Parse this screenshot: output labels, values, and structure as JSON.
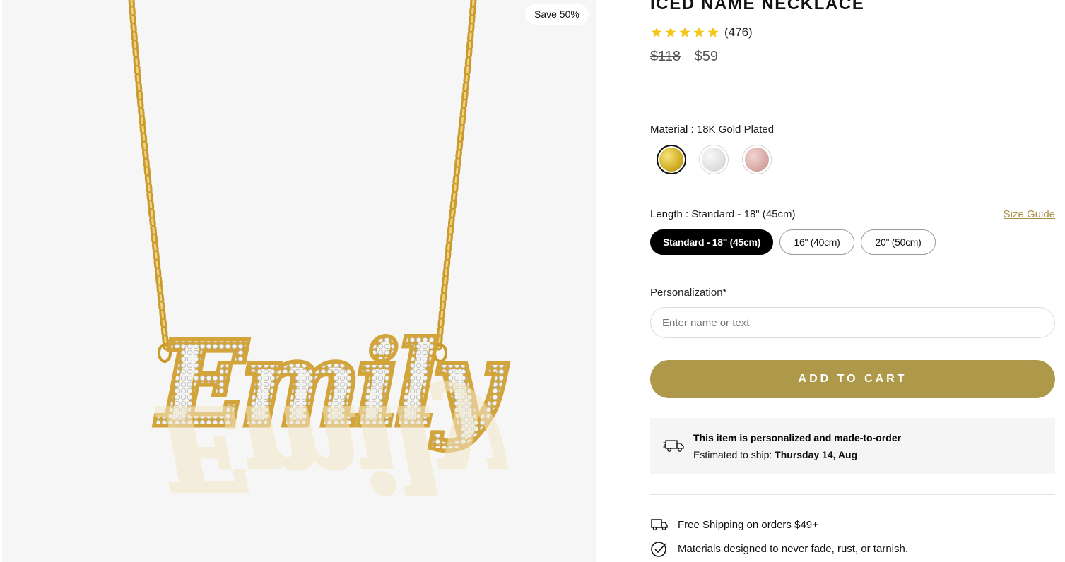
{
  "product": {
    "title": "ICED NAME NECKLACE",
    "badge": "Save 50%",
    "rating_value": 5,
    "star_color": "#f5c518",
    "review_count": "(476)",
    "price_original": "$118",
    "price_sale": "$59",
    "necklace_name": "Emily"
  },
  "material": {
    "label": "Material :",
    "selected": "18K Gold Plated",
    "swatches": [
      {
        "name": "18K Gold Plated",
        "color": "#d4b32b"
      },
      {
        "name": "Silver",
        "color": "#e4e4e6"
      },
      {
        "name": "Rose Gold",
        "color": "#d9a9a7"
      }
    ]
  },
  "length": {
    "label": "Length :",
    "selected": "Standard - 18\" (45cm)",
    "size_guide": "Size Guide",
    "options": [
      "Standard - 18\" (45cm)",
      "16\" (40cm)",
      "20\" (50cm)"
    ]
  },
  "personalization": {
    "label": "Personalization*",
    "placeholder": "Enter name or text",
    "value": ""
  },
  "cart": {
    "button_label": "ADD TO CART",
    "accent_color": "#ae984a"
  },
  "shipping_notice": {
    "title": "This item is personalized and made-to-order",
    "estimate_prefix": "Estimated to ship:",
    "estimate_date": "Thursday 14, Aug"
  },
  "features": [
    {
      "icon": "truck-icon",
      "text": "Free Shipping on orders $49+"
    },
    {
      "icon": "check-circle-icon",
      "text": "Materials designed to never fade, rust, or tarnish."
    }
  ]
}
